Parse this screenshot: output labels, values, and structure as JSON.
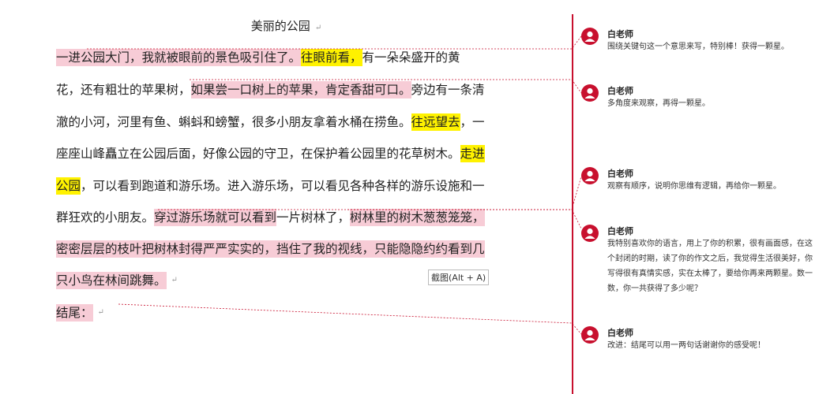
{
  "document": {
    "title": "美丽的公园",
    "lines": [
      [
        {
          "t": "一进公园大门，我就被眼前的景色吸引住了。",
          "h": "pink"
        },
        {
          "t": "往眼前看，",
          "h": "yellow"
        },
        {
          "t": "有一朵朵盛开的黄",
          "h": ""
        }
      ],
      [
        {
          "t": "花，还有粗壮的苹果树，",
          "h": ""
        },
        {
          "t": "如果尝一口树上的苹果，肯定香甜可口。",
          "h": "pink"
        },
        {
          "t": "旁边有一条清",
          "h": ""
        }
      ],
      [
        {
          "t": "澈的小河，河里有鱼、蝌蚪和螃蟹，很多小朋友拿着水桶在捞鱼。",
          "h": ""
        },
        {
          "t": "往远望去",
          "h": "yellow"
        },
        {
          "t": "，一",
          "h": ""
        }
      ],
      [
        {
          "t": "座座山峰矗立在公园后面，好像公园的守卫，在保护着公园里的花草树木。",
          "h": ""
        },
        {
          "t": "走进",
          "h": "yellow"
        }
      ],
      [
        {
          "t": "公园",
          "h": "yellow"
        },
        {
          "t": "，可以看到跑道和游乐场。进入游乐场，可以看见各种各样的游乐设施和一",
          "h": ""
        }
      ],
      [
        {
          "t": "群狂欢的小朋友。",
          "h": ""
        },
        {
          "t": "穿过游乐场就可以看到",
          "h": "pink"
        },
        {
          "t": "一片树林了，",
          "h": ""
        },
        {
          "t": "树林里的树木葱葱笼笼，",
          "h": "pink"
        }
      ],
      [
        {
          "t": "密密层层的枝叶把树林封得严严实实的，挡住了我的视线，只能隐隐约约看到几",
          "h": "pink"
        }
      ],
      [
        {
          "t": "只小鸟在林间跳舞。",
          "h": "pink"
        }
      ],
      [
        {
          "t": "    结尾：",
          "h": "pink"
        }
      ]
    ],
    "screenshot_tip": "截图(Alt + A)"
  },
  "comments": [
    {
      "author": "白老师",
      "text": "围绕关键句这一个意思来写，特别棒！获得一颗星。"
    },
    {
      "author": "白老师",
      "text": "多角度来观察，再得一颗星。"
    },
    {
      "author": "白老师",
      "text": "观察有顺序，说明你思维有逻辑，再给你一颗星。"
    },
    {
      "author": "白老师",
      "text": "我特别喜欢你的语言，用上了你的积累，很有画面感，在这个封闭的时期，读了你的作文之后，我觉得生活很美好，你写得很有真情实感，实在太棒了，要给你再来两颗星。数一数，你一共获得了多少呢？"
    },
    {
      "author": "白老师",
      "text": "改进：结尾可以用一两句话谢谢你的感受呢！"
    }
  ],
  "colors": {
    "highlight_pink": "#f7ccd6",
    "highlight_yellow": "#fff200",
    "comment_accent": "#c8102e"
  }
}
